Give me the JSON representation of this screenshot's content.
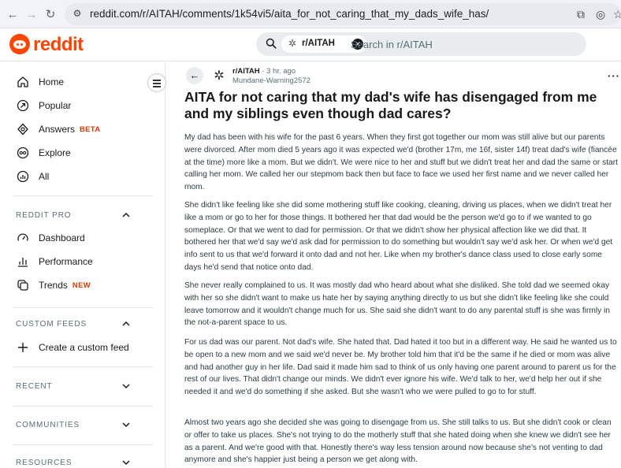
{
  "browser": {
    "url": "reddit.com/r/AITAH/comments/1k54vi5/aita_for_not_caring_that_my_dads_wife_has/"
  },
  "header": {
    "logo_text": "reddit",
    "search_chip": "r/AITAH",
    "search_placeholder": "Search in r/AITAH"
  },
  "sidebar": {
    "nav": [
      {
        "label": "Home",
        "icon": "home-icon"
      },
      {
        "label": "Popular",
        "icon": "popular-icon"
      },
      {
        "label": "Answers",
        "badge": "BETA",
        "icon": "answers-icon"
      },
      {
        "label": "Explore",
        "icon": "explore-icon"
      },
      {
        "label": "All",
        "icon": "all-icon"
      }
    ],
    "reddit_pro": {
      "heading": "REDDIT PRO",
      "items": [
        {
          "label": "Dashboard"
        },
        {
          "label": "Performance"
        },
        {
          "label": "Trends",
          "badge": "NEW"
        }
      ]
    },
    "custom_feeds": {
      "heading": "CUSTOM FEEDS",
      "create_label": "Create a custom feed"
    },
    "recent": {
      "heading": "RECENT"
    },
    "communities": {
      "heading": "COMMUNITIES"
    },
    "resources": {
      "heading": "RESOURCES"
    }
  },
  "post": {
    "subreddit": "r/AITAH",
    "age": "3 hr. ago",
    "author": "Mundane-Warning2572",
    "title": "AITA for not caring that my dad's wife has disengaged from me and my siblings even though dad cares?",
    "paragraphs": [
      "My dad has been with his wife for the past 6 years. When they first got together our mom was still alive but our parents were divorced. After mom died 5 years ago it was expected we'd (brother 17m, me 16f, sister 14f) treat dad's wife (fiancée at the time) more like a mom. But we didn't. We were nice to her and stuff but we didn't treat her and dad the same or start calling her mom. We called her our stepmom back then but face to face we used her first name and we never called her mom.",
      "She didn't like feeling like she did some mothering stuff like cooking, cleaning, driving us places, when we didn't treat her like a mom or go to her for those things. It bothered her that dad would be the person we'd go to if we wanted to go someplace. Or that we went to dad for permission. Or that we didn't show her physical affection like we did that. It bothered her that we'd say we'd ask dad for permission to do something but wouldn't say we'd ask her. Or when we'd get info sent to us that we'd forward it onto dad and not her. Like when my brother's dance class used to close early some days he'd send that notice onto dad.",
      "She never really complained to us. It was mostly dad who heard about what she disliked. She told dad we seemed okay with her so she didn't want to make us hate her by saying anything directly to us but she didn't like feeling like she could leave tomorrow and it wouldn't change much for us. She said she didn't want to do any parental stuff is she was firmly in the not-a-parent space to us.",
      "For us dad was our parent. Not dad's wife. She hated that. Dad hated it too but in a different way. He said he wanted us to be open to a new mom and we said we'd never be. My brother told him that it'd be the same if he died or mom was alive and had another guy in her life. Dad said it made him sad to think of us only having one parent around to parent us for the rest of our lives. That didn't change our minds. We didn't ever ignore his wife. We'd talk to her, we'd help her out if she needed it and we'd do something if she asked. But she wasn't who we were pulled to go to for stuff.",
      "Almost two years ago she decided she was going to disengage from us. She still talks to us. But she didn't cook or clean or offer to take us places. She's not trying to do the motherly stuff that she hated doing when she knew we didn't see her as a parent. And we're good with that. Honestly there's way less tension around now because she's not venting to dad anymore and she's happier just being a person we get along with."
    ]
  },
  "colors": {
    "brand": "#ff4500",
    "badge": "#d93a00",
    "body_text": "#2a3c42"
  }
}
